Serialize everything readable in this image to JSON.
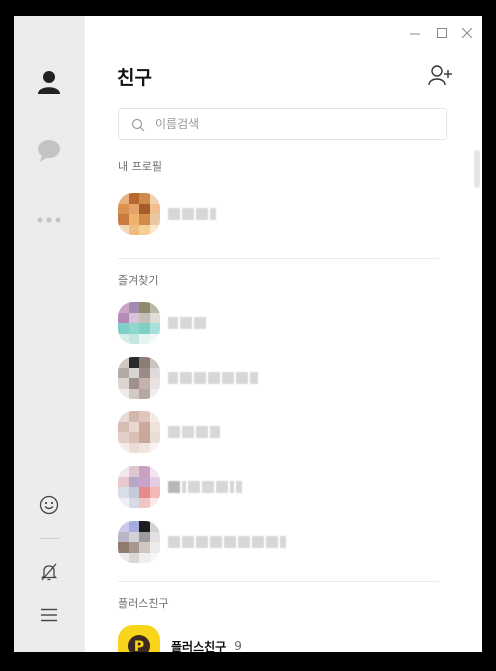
{
  "page": {
    "title": "친구"
  },
  "search": {
    "placeholder": "이름검색",
    "value": ""
  },
  "sections": {
    "my_profile": "내 프로필",
    "favorites": "즐겨찾기",
    "plus_friends": "플러스친구"
  },
  "plus_friend": {
    "name": "플러스친구",
    "count": "9"
  },
  "sidebar": {
    "items": [
      {
        "icon": "person-icon",
        "active": true
      },
      {
        "icon": "chat-bubble-icon",
        "active": false
      },
      {
        "icon": "more-icon",
        "active": false
      }
    ],
    "bottom": [
      {
        "icon": "emoticon-icon"
      },
      {
        "icon": "notification-off-icon"
      },
      {
        "icon": "menu-icon"
      }
    ]
  },
  "colors": {
    "sidebar_bg": "#ececed",
    "accent_yellow": "#f8d51a",
    "text_primary": "#111111"
  }
}
